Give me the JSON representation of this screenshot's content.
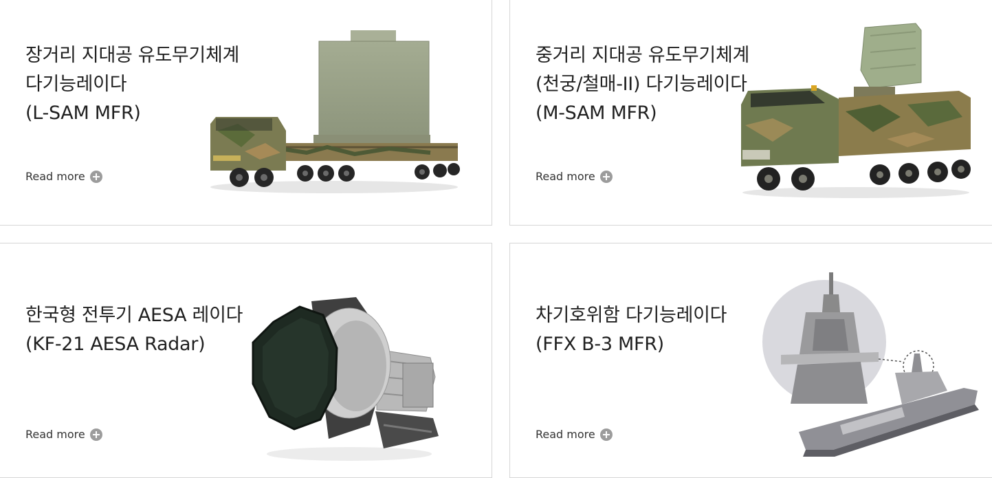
{
  "cards": [
    {
      "title_lines": [
        "장거리 지대공 유도무기체계",
        "다기능레이다",
        "(L-SAM MFR)"
      ],
      "read_more": "Read more",
      "image": "lsam-radar-truck-image"
    },
    {
      "title_lines": [
        "중거리 지대공 유도무기체계",
        "(천궁/철매-II) 다기능레이다",
        "(M-SAM MFR)"
      ],
      "read_more": "Read more",
      "image": "msam-radar-truck-image"
    },
    {
      "title_lines": [
        "한국형 전투기 AESA 레이다",
        "(KF-21 AESA Radar)"
      ],
      "read_more": "Read more",
      "image": "aesa-radar-unit-image"
    },
    {
      "title_lines": [
        "차기호위함 다기능레이다",
        "(FFX B-3 MFR)"
      ],
      "read_more": "Read more",
      "image": "frigate-mfr-image"
    }
  ],
  "icons": {
    "read_more": "plus-circle-icon"
  },
  "colors": {
    "card_border": "#d6d6d6",
    "icon_bg": "#9c9c9c",
    "camo_green": "#7a7a55"
  }
}
